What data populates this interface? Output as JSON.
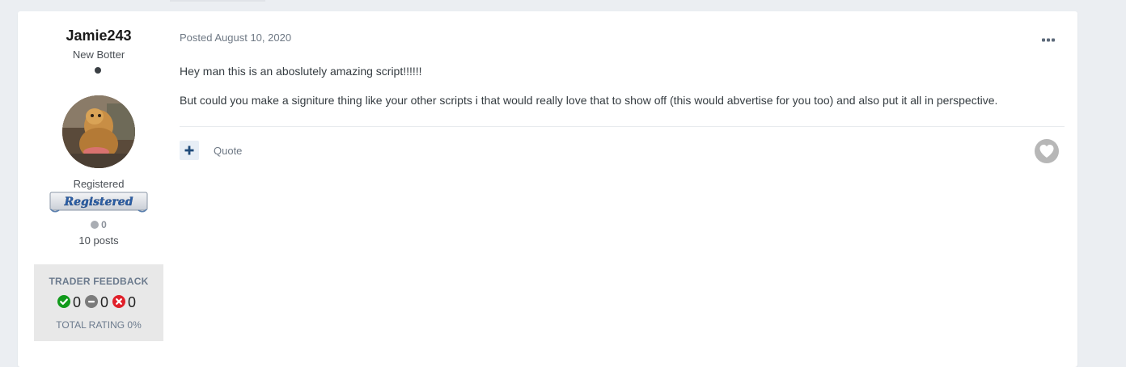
{
  "author": {
    "name": "Jamie243",
    "title": "New Botter",
    "group": "Registered",
    "badge_text": "Registered",
    "reputation": "0",
    "posts": "10 posts"
  },
  "trader_feedback": {
    "title": "TRADER FEEDBACK",
    "positive": "0",
    "neutral": "0",
    "negative": "0",
    "total_rating": "TOTAL RATING 0%"
  },
  "post": {
    "meta": "Posted August 10, 2020",
    "paragraphs": [
      "Hey man this is an aboslutely amazing script!!!!!!",
      "But could you make a signiture thing like your other scripts i that would really love that to show off (this would abvertise for you too) and also put it all in perspective."
    ]
  },
  "actions": {
    "quote_label": "Quote"
  },
  "icons": {
    "more": "more-horizontal-icon",
    "plus": "plus-icon",
    "like": "heart-icon",
    "positive": "check-circle-icon",
    "neutral": "minus-circle-icon",
    "negative": "x-circle-icon"
  },
  "colors": {
    "page_bg": "#ebeef2",
    "card_bg": "#ffffff",
    "positive": "#119a1b",
    "neutral": "#7b7b7b",
    "negative": "#e0202a",
    "plus_bg": "#e7eef6",
    "plus_fg": "#1e4a7a"
  }
}
